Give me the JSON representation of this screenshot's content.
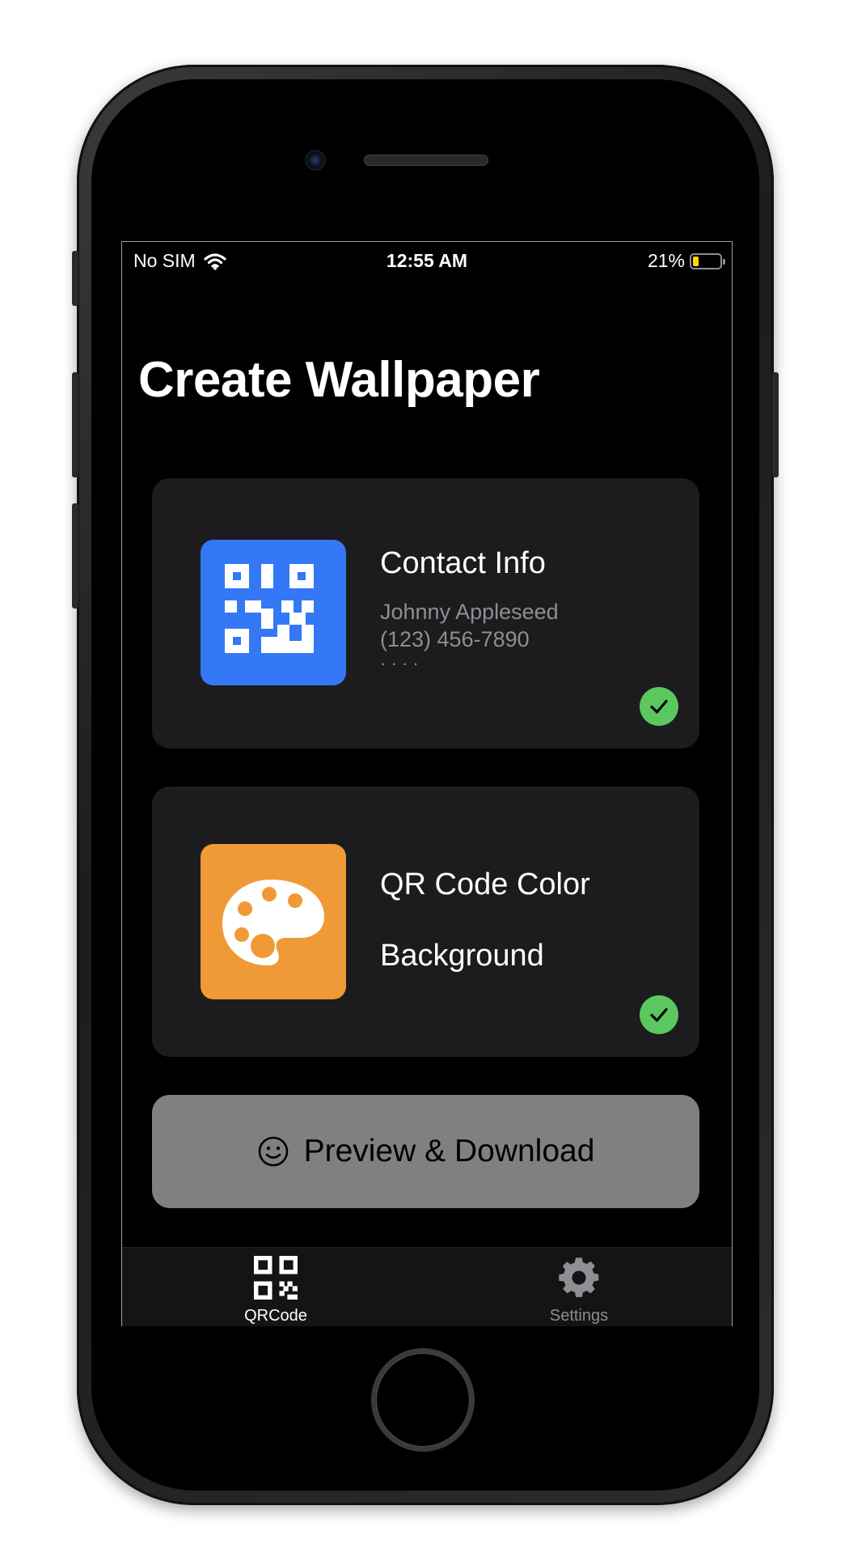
{
  "status_bar": {
    "carrier": "No SIM",
    "time": "12:55 AM",
    "battery_percent": "21%",
    "battery_level": 0.21,
    "battery_color": "#ffd60a"
  },
  "page": {
    "title": "Create Wallpaper"
  },
  "cards": {
    "contact": {
      "icon": "qr-code-icon",
      "icon_bg": "#3478f6",
      "title": "Contact Info",
      "line1": "Johnny Appleseed",
      "line2": "(123) 456-7890",
      "line3": "· · · ·",
      "completed": true
    },
    "color": {
      "icon": "palette-icon",
      "icon_bg": "#f09a37",
      "title": "QR Code Color",
      "subtitle": "Background",
      "completed": true
    }
  },
  "action": {
    "icon": "smiley-icon",
    "label": "Preview & Download"
  },
  "tabbar": {
    "tabs": [
      {
        "label": "QRCode",
        "icon": "qr-code-icon",
        "selected": true
      },
      {
        "label": "Settings",
        "icon": "gear-icon",
        "selected": false
      }
    ]
  },
  "colors": {
    "check_green": "#5ac85f",
    "card_bg": "#1c1c1e",
    "button_bg": "#808080"
  }
}
